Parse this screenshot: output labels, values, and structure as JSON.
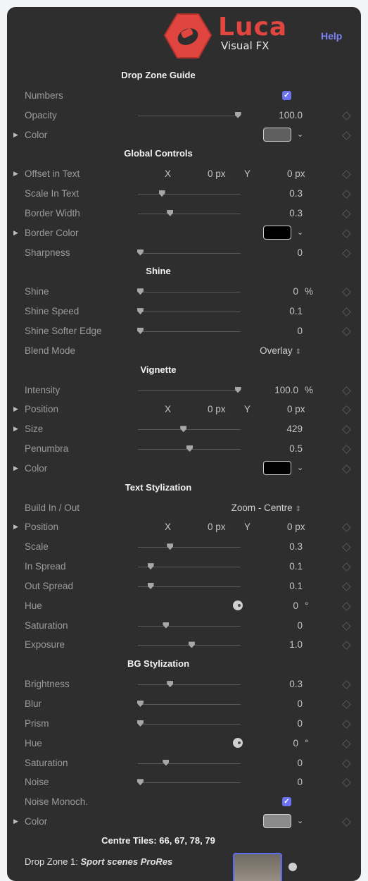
{
  "header": {
    "brand_name": "Luca",
    "brand_sub": "Visual FX",
    "help_label": "Help",
    "logo_color": "#e0463f"
  },
  "rows": [
    {
      "type": "section",
      "title": "Drop Zone Guide"
    },
    {
      "type": "check",
      "label": "Numbers",
      "checked": true
    },
    {
      "type": "slider",
      "label": "Opacity",
      "value": "100.0",
      "unit": "",
      "level": 0.97
    },
    {
      "type": "color",
      "label": "Color",
      "expand": true,
      "swatch": "#5f5f5f"
    },
    {
      "type": "section",
      "title": "Global Controls"
    },
    {
      "type": "xy",
      "label": "Offset in Text",
      "expand": true,
      "x_label": "X",
      "x_value": "0 px",
      "y_label": "Y",
      "y_value": "0 px"
    },
    {
      "type": "slider",
      "label": "Scale In Text",
      "value": "0.3",
      "unit": "",
      "level": 0.23
    },
    {
      "type": "slider",
      "label": "Border Width",
      "value": "0.3",
      "unit": "",
      "level": 0.31
    },
    {
      "type": "color",
      "label": "Border Color",
      "expand": true,
      "swatch": "#000000"
    },
    {
      "type": "slider",
      "label": "Sharpness",
      "value": "0",
      "unit": "",
      "level": 0.02
    },
    {
      "type": "section",
      "title": "Shine"
    },
    {
      "type": "slider",
      "label": "Shine",
      "value": "0",
      "unit": "%",
      "level": 0.02
    },
    {
      "type": "slider",
      "label": "Shine Speed",
      "value": "0.1",
      "unit": "",
      "level": 0.02
    },
    {
      "type": "slider",
      "label": "Shine Softer Edge",
      "value": "0",
      "unit": "",
      "level": 0.02
    },
    {
      "type": "popup",
      "label": "Blend Mode",
      "value": "Overlay"
    },
    {
      "type": "section",
      "title": "Vignette"
    },
    {
      "type": "slider",
      "label": "Intensity",
      "value": "100.0",
      "unit": "%",
      "level": 0.97
    },
    {
      "type": "xy",
      "label": "Position",
      "expand": true,
      "x_label": "X",
      "x_value": "0 px",
      "y_label": "Y",
      "y_value": "0 px"
    },
    {
      "type": "slider",
      "label": "Size",
      "value": "429",
      "unit": "",
      "level": 0.44,
      "expand": true
    },
    {
      "type": "slider",
      "label": "Penumbra",
      "value": "0.5",
      "unit": "",
      "level": 0.5
    },
    {
      "type": "color",
      "label": "Color",
      "expand": true,
      "swatch": "#000000"
    },
    {
      "type": "section",
      "title": "Text Stylization"
    },
    {
      "type": "popup",
      "label": "Build In / Out",
      "value": "Zoom - Centre"
    },
    {
      "type": "xy",
      "label": "Position",
      "expand": true,
      "x_label": "X",
      "x_value": "0 px",
      "y_label": "Y",
      "y_value": "0 px"
    },
    {
      "type": "slider",
      "label": "Scale",
      "value": "0.3",
      "unit": "",
      "level": 0.31
    },
    {
      "type": "slider",
      "label": "In Spread",
      "value": "0.1",
      "unit": "",
      "level": 0.12
    },
    {
      "type": "slider",
      "label": "Out Spread",
      "value": "0.1",
      "unit": "",
      "level": 0.12
    },
    {
      "type": "dial",
      "label": "Hue",
      "value": "0",
      "unit": "°"
    },
    {
      "type": "slider",
      "label": "Saturation",
      "value": "0",
      "unit": "",
      "level": 0.27
    },
    {
      "type": "slider",
      "label": "Exposure",
      "value": "1.0",
      "unit": "",
      "level": 0.52
    },
    {
      "type": "section",
      "title": "BG Stylization"
    },
    {
      "type": "slider",
      "label": "Brightness",
      "value": "0.3",
      "unit": "",
      "level": 0.31
    },
    {
      "type": "slider",
      "label": "Blur",
      "value": "0",
      "unit": "",
      "level": 0.02
    },
    {
      "type": "slider",
      "label": "Prism",
      "value": "0",
      "unit": "",
      "level": 0.02
    },
    {
      "type": "dial",
      "label": "Hue",
      "value": "0",
      "unit": "°"
    },
    {
      "type": "slider",
      "label": "Saturation",
      "value": "0",
      "unit": "",
      "level": 0.27
    },
    {
      "type": "slider",
      "label": "Noise",
      "value": "0",
      "unit": "",
      "level": 0.02
    },
    {
      "type": "check",
      "label": "Noise Monoch.",
      "checked": true
    },
    {
      "type": "color",
      "label": "Color",
      "expand": true,
      "swatch": "#8a8a8a"
    },
    {
      "type": "section",
      "title": "Centre Tiles: 66, 67, 78, 79"
    },
    {
      "type": "dropzone",
      "label": "Drop Zone 1:",
      "source": "Sport scenes ProRes"
    }
  ]
}
